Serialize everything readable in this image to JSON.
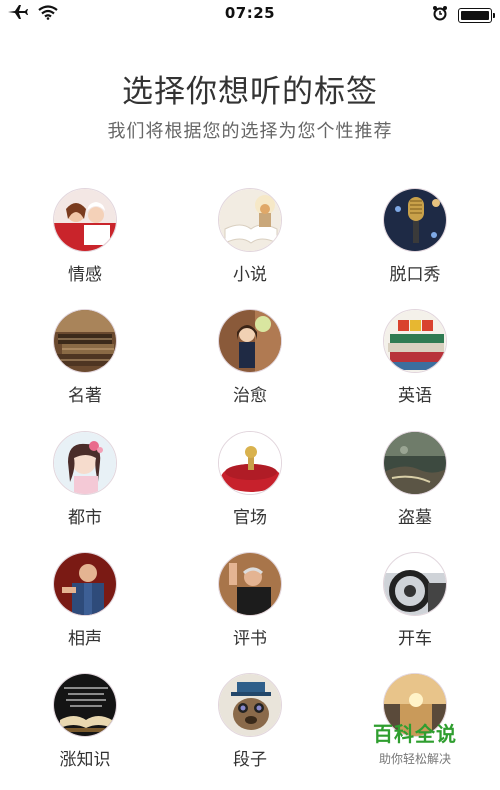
{
  "status_bar": {
    "time": "07:25",
    "icons": [
      "airplane-icon",
      "wifi-icon",
      "alarm-icon",
      "battery-icon"
    ]
  },
  "header": {
    "title": "选择你想听的标签",
    "subtitle": "我们将根据您的选择为您个性推荐"
  },
  "tags": [
    {
      "label": "情感",
      "icon": "couple-photo"
    },
    {
      "label": "小说",
      "icon": "open-book-photo"
    },
    {
      "label": "脱口秀",
      "icon": "microphone-photo"
    },
    {
      "label": "名著",
      "icon": "old-books-photo"
    },
    {
      "label": "治愈",
      "icon": "girl-photo"
    },
    {
      "label": "英语",
      "icon": "abc-books-photo"
    },
    {
      "label": "都市",
      "icon": "city-girl-photo"
    },
    {
      "label": "官场",
      "icon": "seal-photo"
    },
    {
      "label": "盗墓",
      "icon": "cave-photo"
    },
    {
      "label": "相声",
      "icon": "crosstalk-photo"
    },
    {
      "label": "评书",
      "icon": "storyteller-photo"
    },
    {
      "label": "开车",
      "icon": "steering-wheel-photo"
    },
    {
      "label": "涨知识",
      "icon": "knowledge-book-photo"
    },
    {
      "label": "段子",
      "icon": "dog-hat-photo"
    },
    {
      "label": "",
      "icon": "sunset-photo"
    }
  ],
  "watermark": {
    "title": "百科全说",
    "subtitle": "助你轻松解决"
  },
  "colors": {
    "text": "#333333",
    "subtitle": "#666666",
    "watermark_green": "#2f9e2f"
  }
}
